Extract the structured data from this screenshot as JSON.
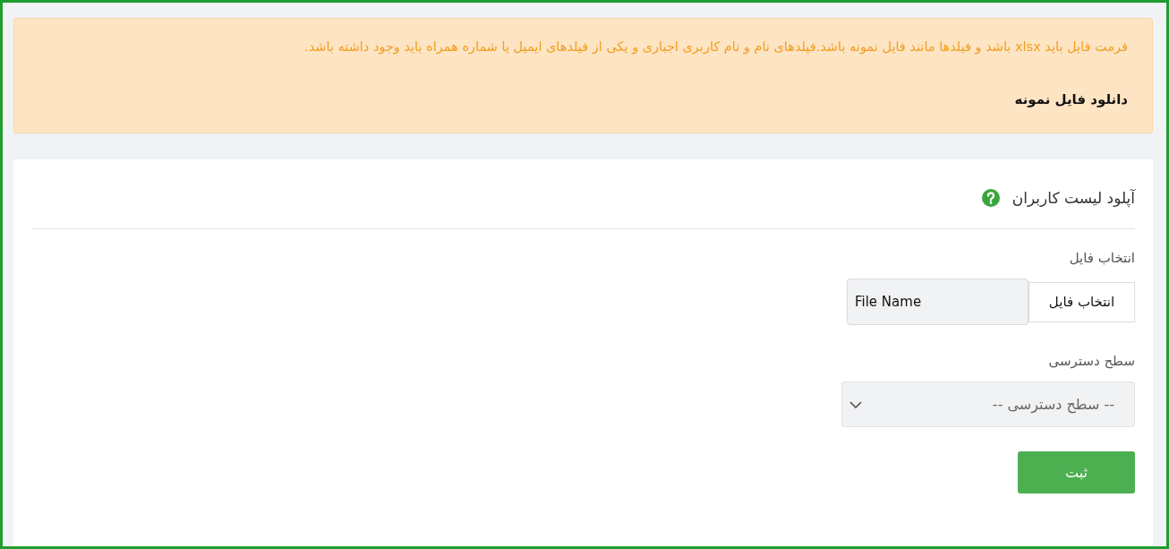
{
  "alert": {
    "message": "فرمت فایل باید xlsx باشد و فیلدها مانند فایل نمونه باشد.فیلدهای نام و نام کاربری اجباری و یکی از فیلدهای ایمیل یا شماره همراه باید وجود داشته باشد.",
    "link": "دانلود فایل نمونه"
  },
  "card": {
    "title": "آپلود لیست کاربران",
    "fields": [
      {
        "kind": "file",
        "label": "انتخاب فایل",
        "button": "انتخاب فایل",
        "value": "File Name"
      },
      {
        "kind": "select",
        "label": "سطح دسترسی",
        "placeholder": "-- سطح دسترسی --"
      }
    ],
    "submit": "ثبت"
  }
}
